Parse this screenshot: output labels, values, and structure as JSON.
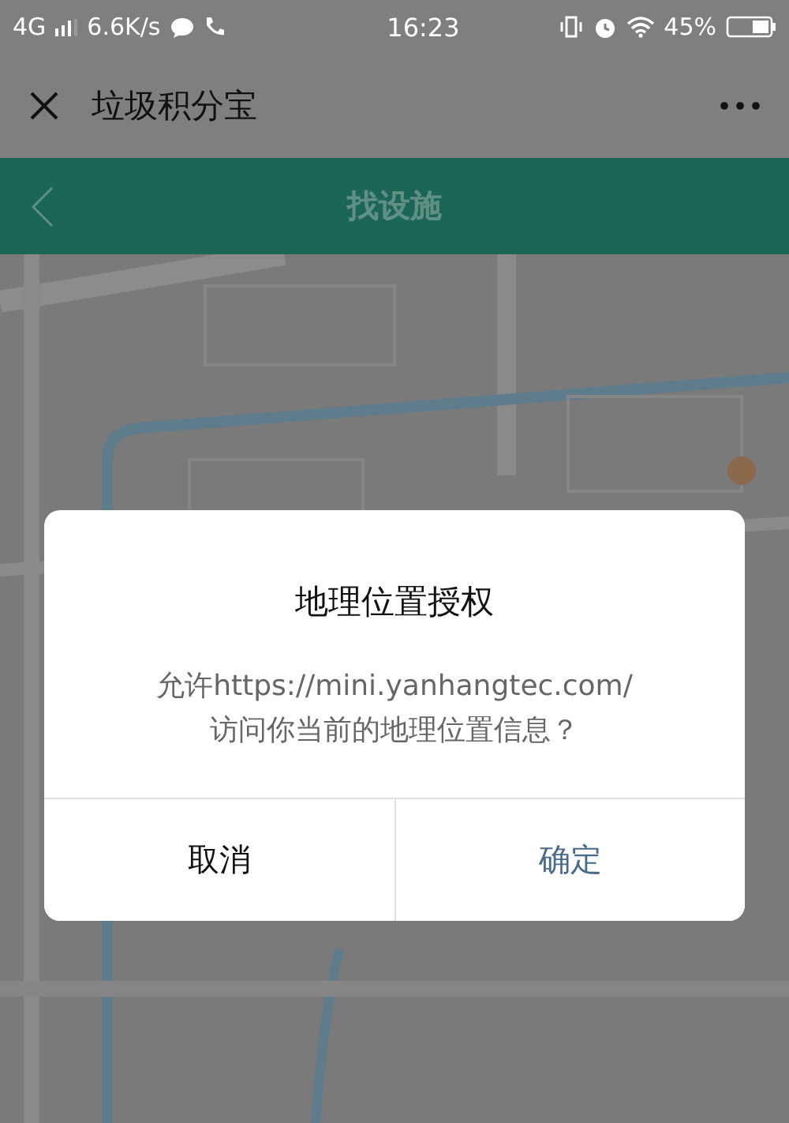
{
  "status_bar": {
    "network": "4G",
    "speed": "6.6K/s",
    "time": "16:23",
    "battery": "45%"
  },
  "app_bar": {
    "title": "垃圾积分宝"
  },
  "nav_bar": {
    "title": "找设施"
  },
  "dialog": {
    "title": "地理位置授权",
    "message_lines": [
      "允许https://mini.yanhangtec.com/",
      "访问你当前的地理位置信息？"
    ],
    "buttons": [
      {
        "label": "取消",
        "kind": "cancel"
      },
      {
        "label": "确定",
        "kind": "confirm"
      }
    ]
  }
}
